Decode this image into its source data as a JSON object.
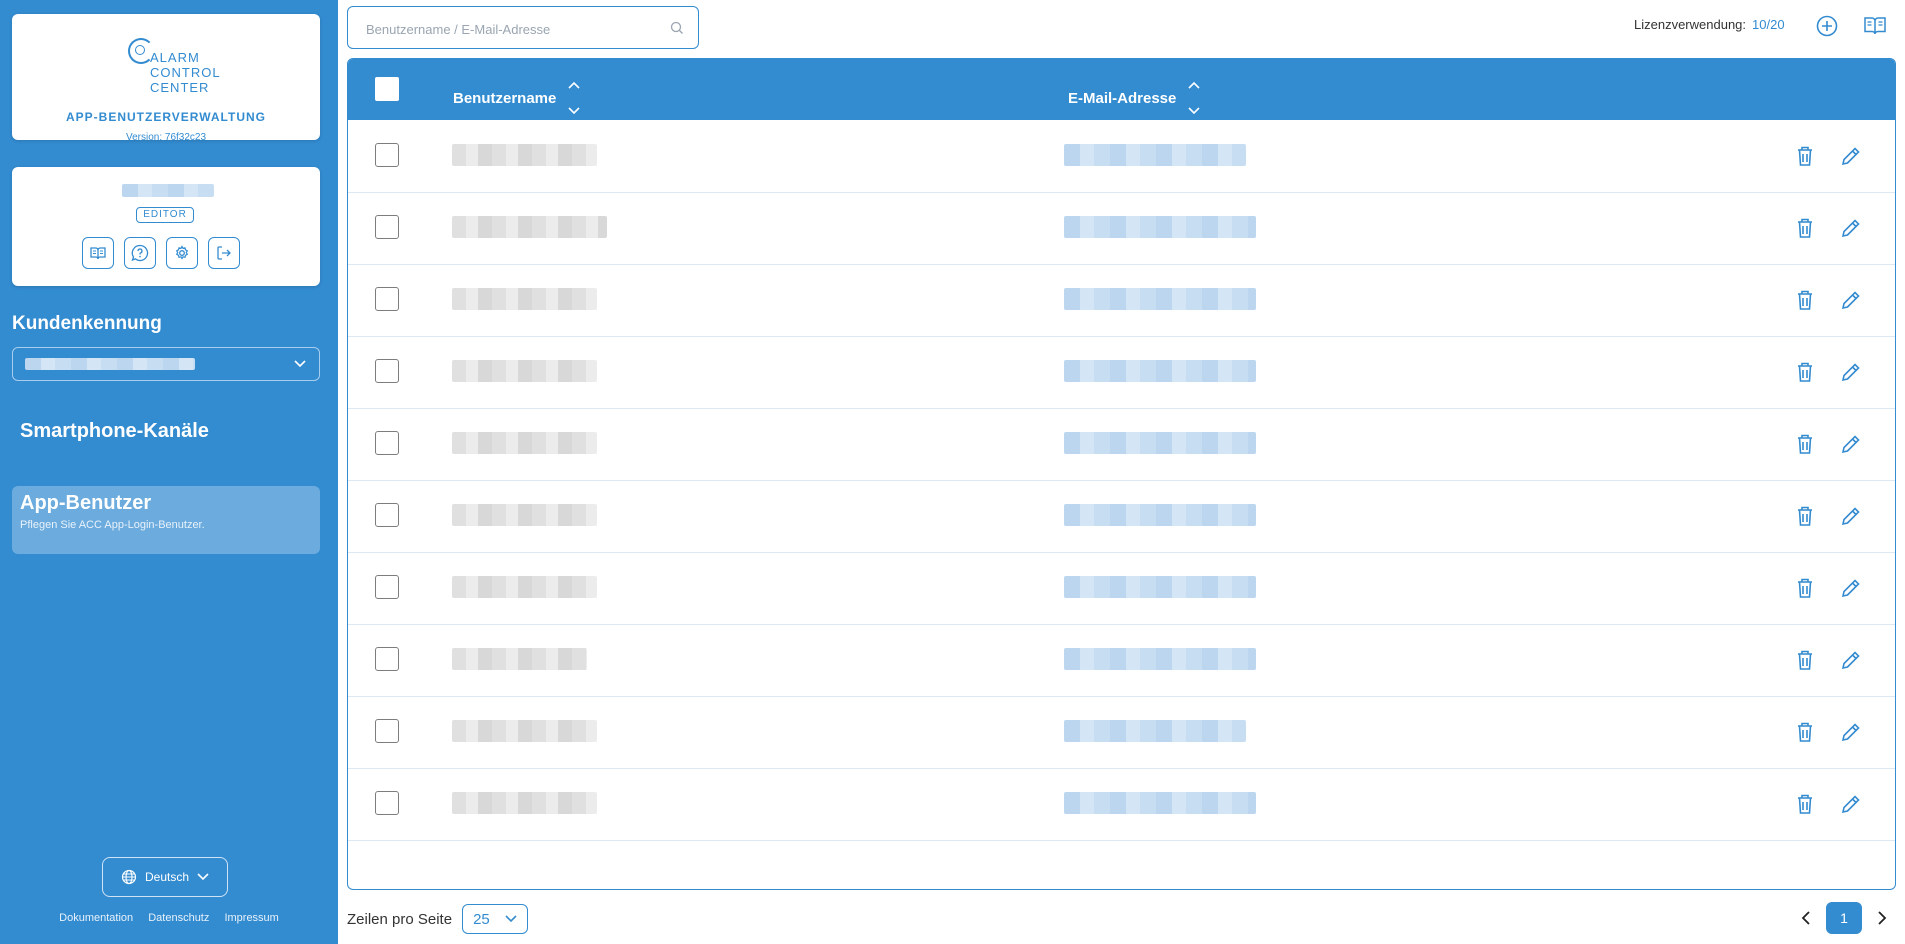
{
  "sidebar": {
    "logo_lines": [
      "ALARM",
      "CONTROL",
      "CENTER"
    ],
    "app_title": "APP-BENUTZERVERWALTUNG",
    "version": "Version: 76f32c23",
    "role_badge": "EDITOR",
    "customer_label": "Kundenkennung",
    "nav": {
      "channels": "Smartphone-Kanäle",
      "users_title": "App-Benutzer",
      "users_desc": "Pflegen Sie ACC App-Login-Benutzer."
    },
    "language": "Deutsch",
    "footer": {
      "docs": "Dokumentation",
      "privacy": "Datenschutz",
      "imprint": "Impressum"
    }
  },
  "toolbar": {
    "search_placeholder": "Benutzername / E-Mail-Adresse",
    "license_label": "Lizenzverwendung:",
    "license_value": "10/20"
  },
  "table": {
    "headers": {
      "username": "Benutzername",
      "email": "E-Mail-Adresse"
    },
    "row_count": 10
  },
  "pagination": {
    "rows_label": "Zeilen pro Seite",
    "rows_value": "25",
    "current_page": "1"
  },
  "colors": {
    "primary": "#338bd0"
  }
}
